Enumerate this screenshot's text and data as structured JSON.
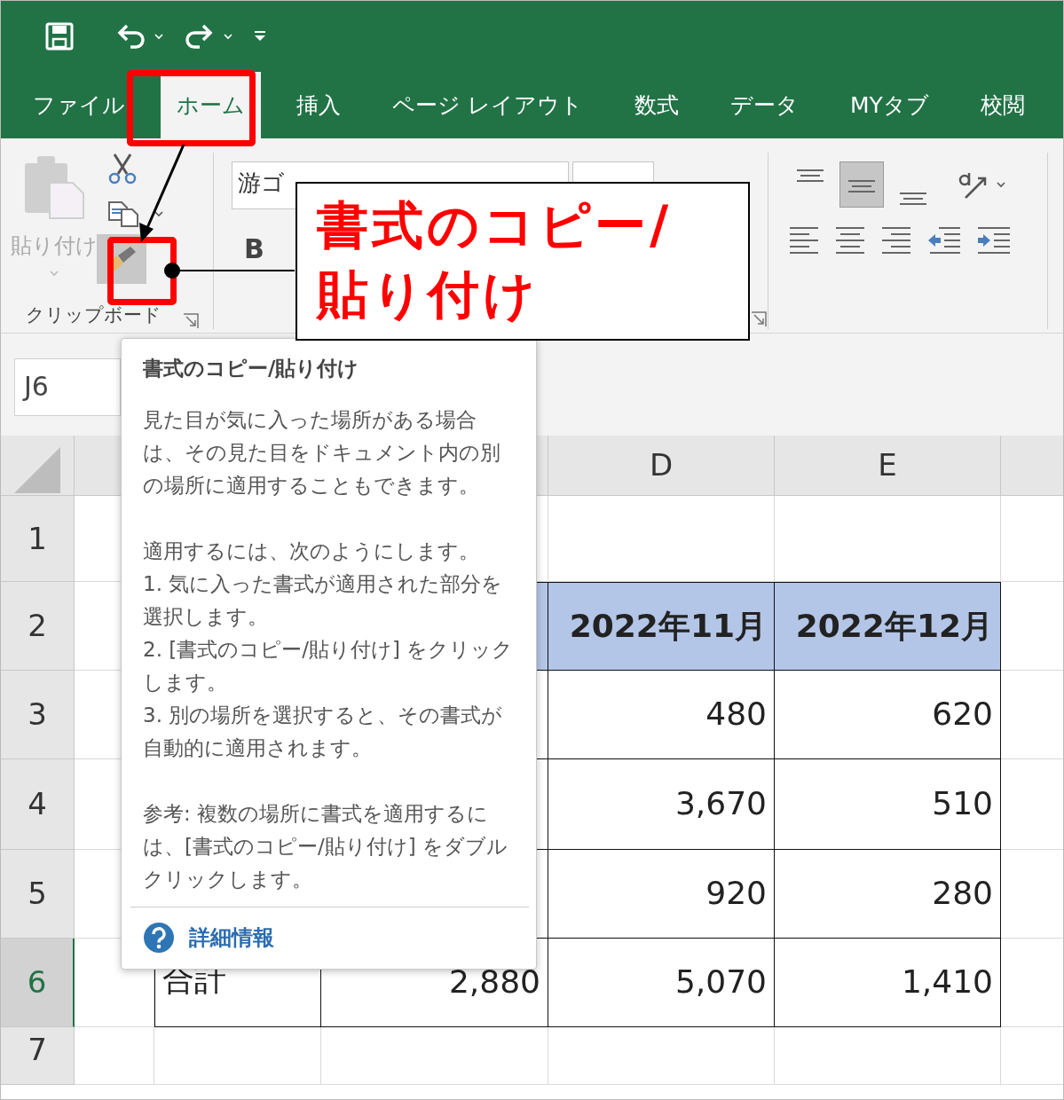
{
  "tabs": [
    {
      "label": "ファイル",
      "selected": false
    },
    {
      "label": "ホーム",
      "selected": true
    },
    {
      "label": "挿入",
      "selected": false
    },
    {
      "label": "ページ レイアウト",
      "selected": false
    },
    {
      "label": "数式",
      "selected": false
    },
    {
      "label": "データ",
      "selected": false
    },
    {
      "label": "MYタブ",
      "selected": false
    },
    {
      "label": "校閲",
      "selected": false
    }
  ],
  "ribbon": {
    "clipboard": {
      "paste_label": "貼り付け",
      "paste_disabled": true,
      "format_painter_active": true,
      "group_label": "クリップボード"
    },
    "font": {
      "font_name": "游ゴ",
      "bold_label": "B"
    },
    "alignment": {
      "vertical_align": [
        {
          "selected": false
        },
        {
          "selected": true
        },
        {
          "selected": false
        }
      ]
    }
  },
  "name_box": {
    "value": "J6"
  },
  "sheet": {
    "column_headers": {
      "D": "D",
      "E": "E"
    },
    "rows": [
      {
        "header": "1",
        "selected": false
      },
      {
        "header": "2",
        "selected": false,
        "kind": "heading",
        "cells": {
          "D": "2022年11月",
          "E": "2022年12月"
        }
      },
      {
        "header": "3",
        "selected": false,
        "kind": "data",
        "cells": {
          "D": "480",
          "E": "620"
        }
      },
      {
        "header": "4",
        "selected": false,
        "kind": "data",
        "cells": {
          "D": "3,670",
          "E": "510"
        }
      },
      {
        "header": "5",
        "selected": false,
        "kind": "data",
        "cells": {
          "D": "920",
          "E": "280"
        }
      },
      {
        "header": "6",
        "selected": true,
        "kind": "data",
        "cells": {
          "B": "合計",
          "C": "2,880",
          "D": "5,070",
          "E": "1,410"
        }
      },
      {
        "header": "7",
        "selected": false
      }
    ]
  },
  "tooltip": {
    "title": "書式のコピー/貼り付け",
    "paragraphs": [
      {
        "lines": [
          "見た目が気に入った場所がある場合は、その見た目をドキュメント内の別の場所に適用することもできます。"
        ]
      },
      {
        "lines": [
          "適用するには、次のようにします。",
          "1. 気に入った書式が適用された部分を選択します。",
          "2. [書式のコピー/貼り付け] をクリックします。",
          "3. 別の場所を選択すると、その書式が自動的に適用されます。"
        ]
      },
      {
        "lines": [
          "参考: 複数の場所に書式を適用するには、[書式のコピー/貼り付け] をダブルクリックします。"
        ]
      }
    ],
    "link": "詳細情報"
  },
  "callout": {
    "lines": [
      "書式のコピー/",
      "貼り付け"
    ]
  }
}
